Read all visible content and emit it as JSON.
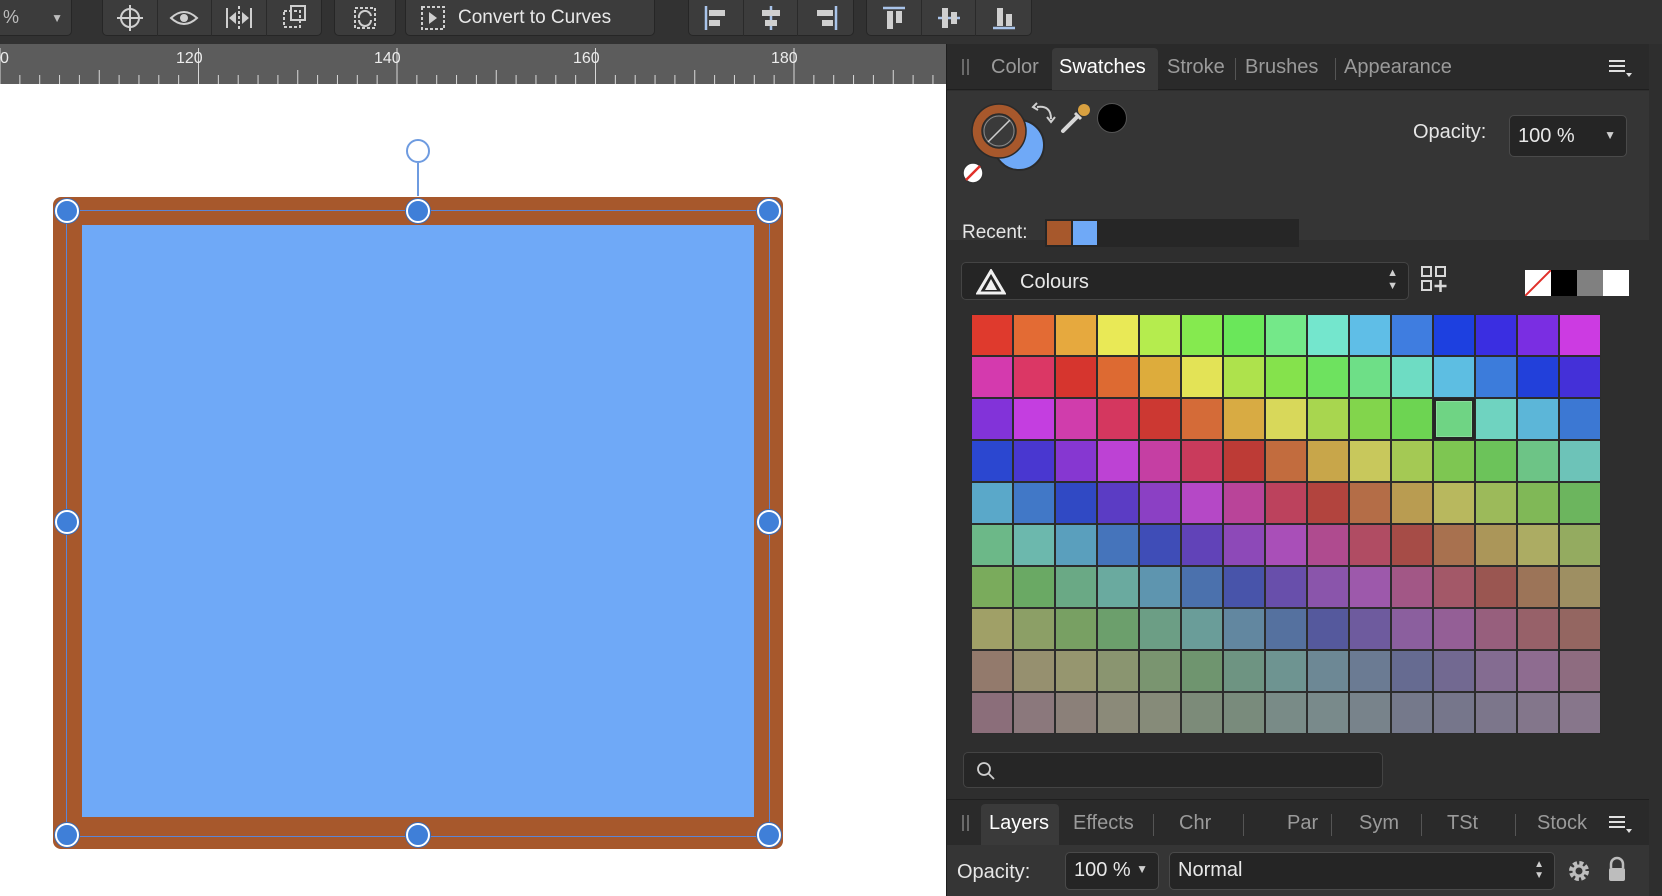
{
  "toolbar": {
    "zoom_value": "%",
    "convert_label": "Convert to Curves"
  },
  "ruler": {
    "labels": [
      "0",
      "120",
      "140",
      "160",
      "180"
    ]
  },
  "panel": {
    "tabs": [
      "Color",
      "Swatches",
      "Stroke",
      "Brushes",
      "Appearance"
    ],
    "active_tab": "Swatches",
    "opacity_label": "Opacity:",
    "opacity_value": "100 %",
    "recent_label": "Recent:",
    "recent_colors": [
      "#a7582c",
      "#6fa9f7"
    ],
    "palette_name": "Colours",
    "stroke_color": "#a7582c",
    "fill_color": "#6fa9f7",
    "search_placeholder": ""
  },
  "swatch_grid": [
    [
      "#df3a2d",
      "#e36b34",
      "#e6a93e",
      "#e9e956",
      "#b5ec4e",
      "#85ea4f",
      "#6ae75a",
      "#74e889",
      "#74e6cd",
      "#5fbee7",
      "#3f7de0",
      "#1d40e0",
      "#3a2ee1",
      "#7a2ee2",
      "#cc3be2"
    ],
    [
      "#d43aae",
      "#db3765",
      "#d6352e",
      "#dd6a32",
      "#ddac3c",
      "#e3e356",
      "#aee24c",
      "#85e24c",
      "#6ee25f",
      "#6edf87",
      "#6edcc3",
      "#5dbee2",
      "#3c7cdb",
      "#2240da",
      "#4430d8"
    ],
    [
      "#8233d9",
      "#c43ee0",
      "#d03dac",
      "#d4375f",
      "#cc3832",
      "#d46b38",
      "#d8ab43",
      "#d8d85a",
      "#a8d64f",
      "#82d54c",
      "#6dd452",
      "#6fd484",
      "#6fd3c0",
      "#5cb6d8",
      "#3c78d3"
    ],
    [
      "#2b47d0",
      "#4937d0",
      "#8637d1",
      "#bd42d4",
      "#c53fa3",
      "#c93b5c",
      "#bd3b36",
      "#c26c3e",
      "#c8a64a",
      "#c8c85c",
      "#a4c954",
      "#7ec652",
      "#6cc35a",
      "#6dc486",
      "#6dc3b8"
    ],
    [
      "#5aa8c9",
      "#4178c7",
      "#3049c4",
      "#5b3cc4",
      "#8b40c4",
      "#b548c6",
      "#b94499",
      "#bc425d",
      "#b2443e",
      "#b46d47",
      "#b99c51",
      "#b8b85e",
      "#9cba5a",
      "#80b857",
      "#6cb55e"
    ],
    [
      "#6cb888",
      "#6cb8ad",
      "#5a9fbd",
      "#4574bb",
      "#3f4db7",
      "#6143b8",
      "#8d49b8",
      "#a94fb8",
      "#af4b8f",
      "#b04c63",
      "#a64c47",
      "#a8714f",
      "#ab9659",
      "#acac63",
      "#94ab60"
    ],
    [
      "#7aab5c",
      "#6aa964",
      "#6aa985",
      "#6aaa9f",
      "#5e95af",
      "#4b71ad",
      "#4854aa",
      "#684fab",
      "#8a55ab",
      "#9d59ab",
      "#a25786",
      "#a35868",
      "#9a5651",
      "#9c7458",
      "#9e8f62"
    ],
    [
      "#a0a067",
      "#8c9f66",
      "#78a063",
      "#6c9f6c",
      "#6c9e85",
      "#6a9d99",
      "#6287a0",
      "#55719f",
      "#55599d",
      "#6e5b9e",
      "#8b5f9e",
      "#945f96",
      "#975f7d",
      "#976169",
      "#946661"
    ],
    [
      "#937a6c",
      "#96906f",
      "#96966f",
      "#8a9570",
      "#7a9570",
      "#6f956f",
      "#6e9482",
      "#6e9491",
      "#6d8895",
      "#6b7b93",
      "#666b91",
      "#726991",
      "#846c91",
      "#8e6c90",
      "#8e6c80"
    ],
    [
      "#8b6e7a",
      "#8b787c",
      "#8b8079",
      "#8b8a79",
      "#868b79",
      "#7c8b79",
      "#798b7c",
      "#798b87",
      "#798a8b",
      "#78838b",
      "#75798b",
      "#76768b",
      "#7c768b",
      "#83768b",
      "#87768b"
    ]
  ],
  "selected_swatch": {
    "row": 2,
    "col": 11
  },
  "bottom": {
    "tabs": [
      "Layers",
      "Effects",
      "Chr",
      "Par",
      "Sym",
      "TSt",
      "Stock"
    ],
    "active_tab": "Layers",
    "opacity_label": "Opacity:",
    "opacity_value": "100 %",
    "blend_mode": "Normal"
  }
}
